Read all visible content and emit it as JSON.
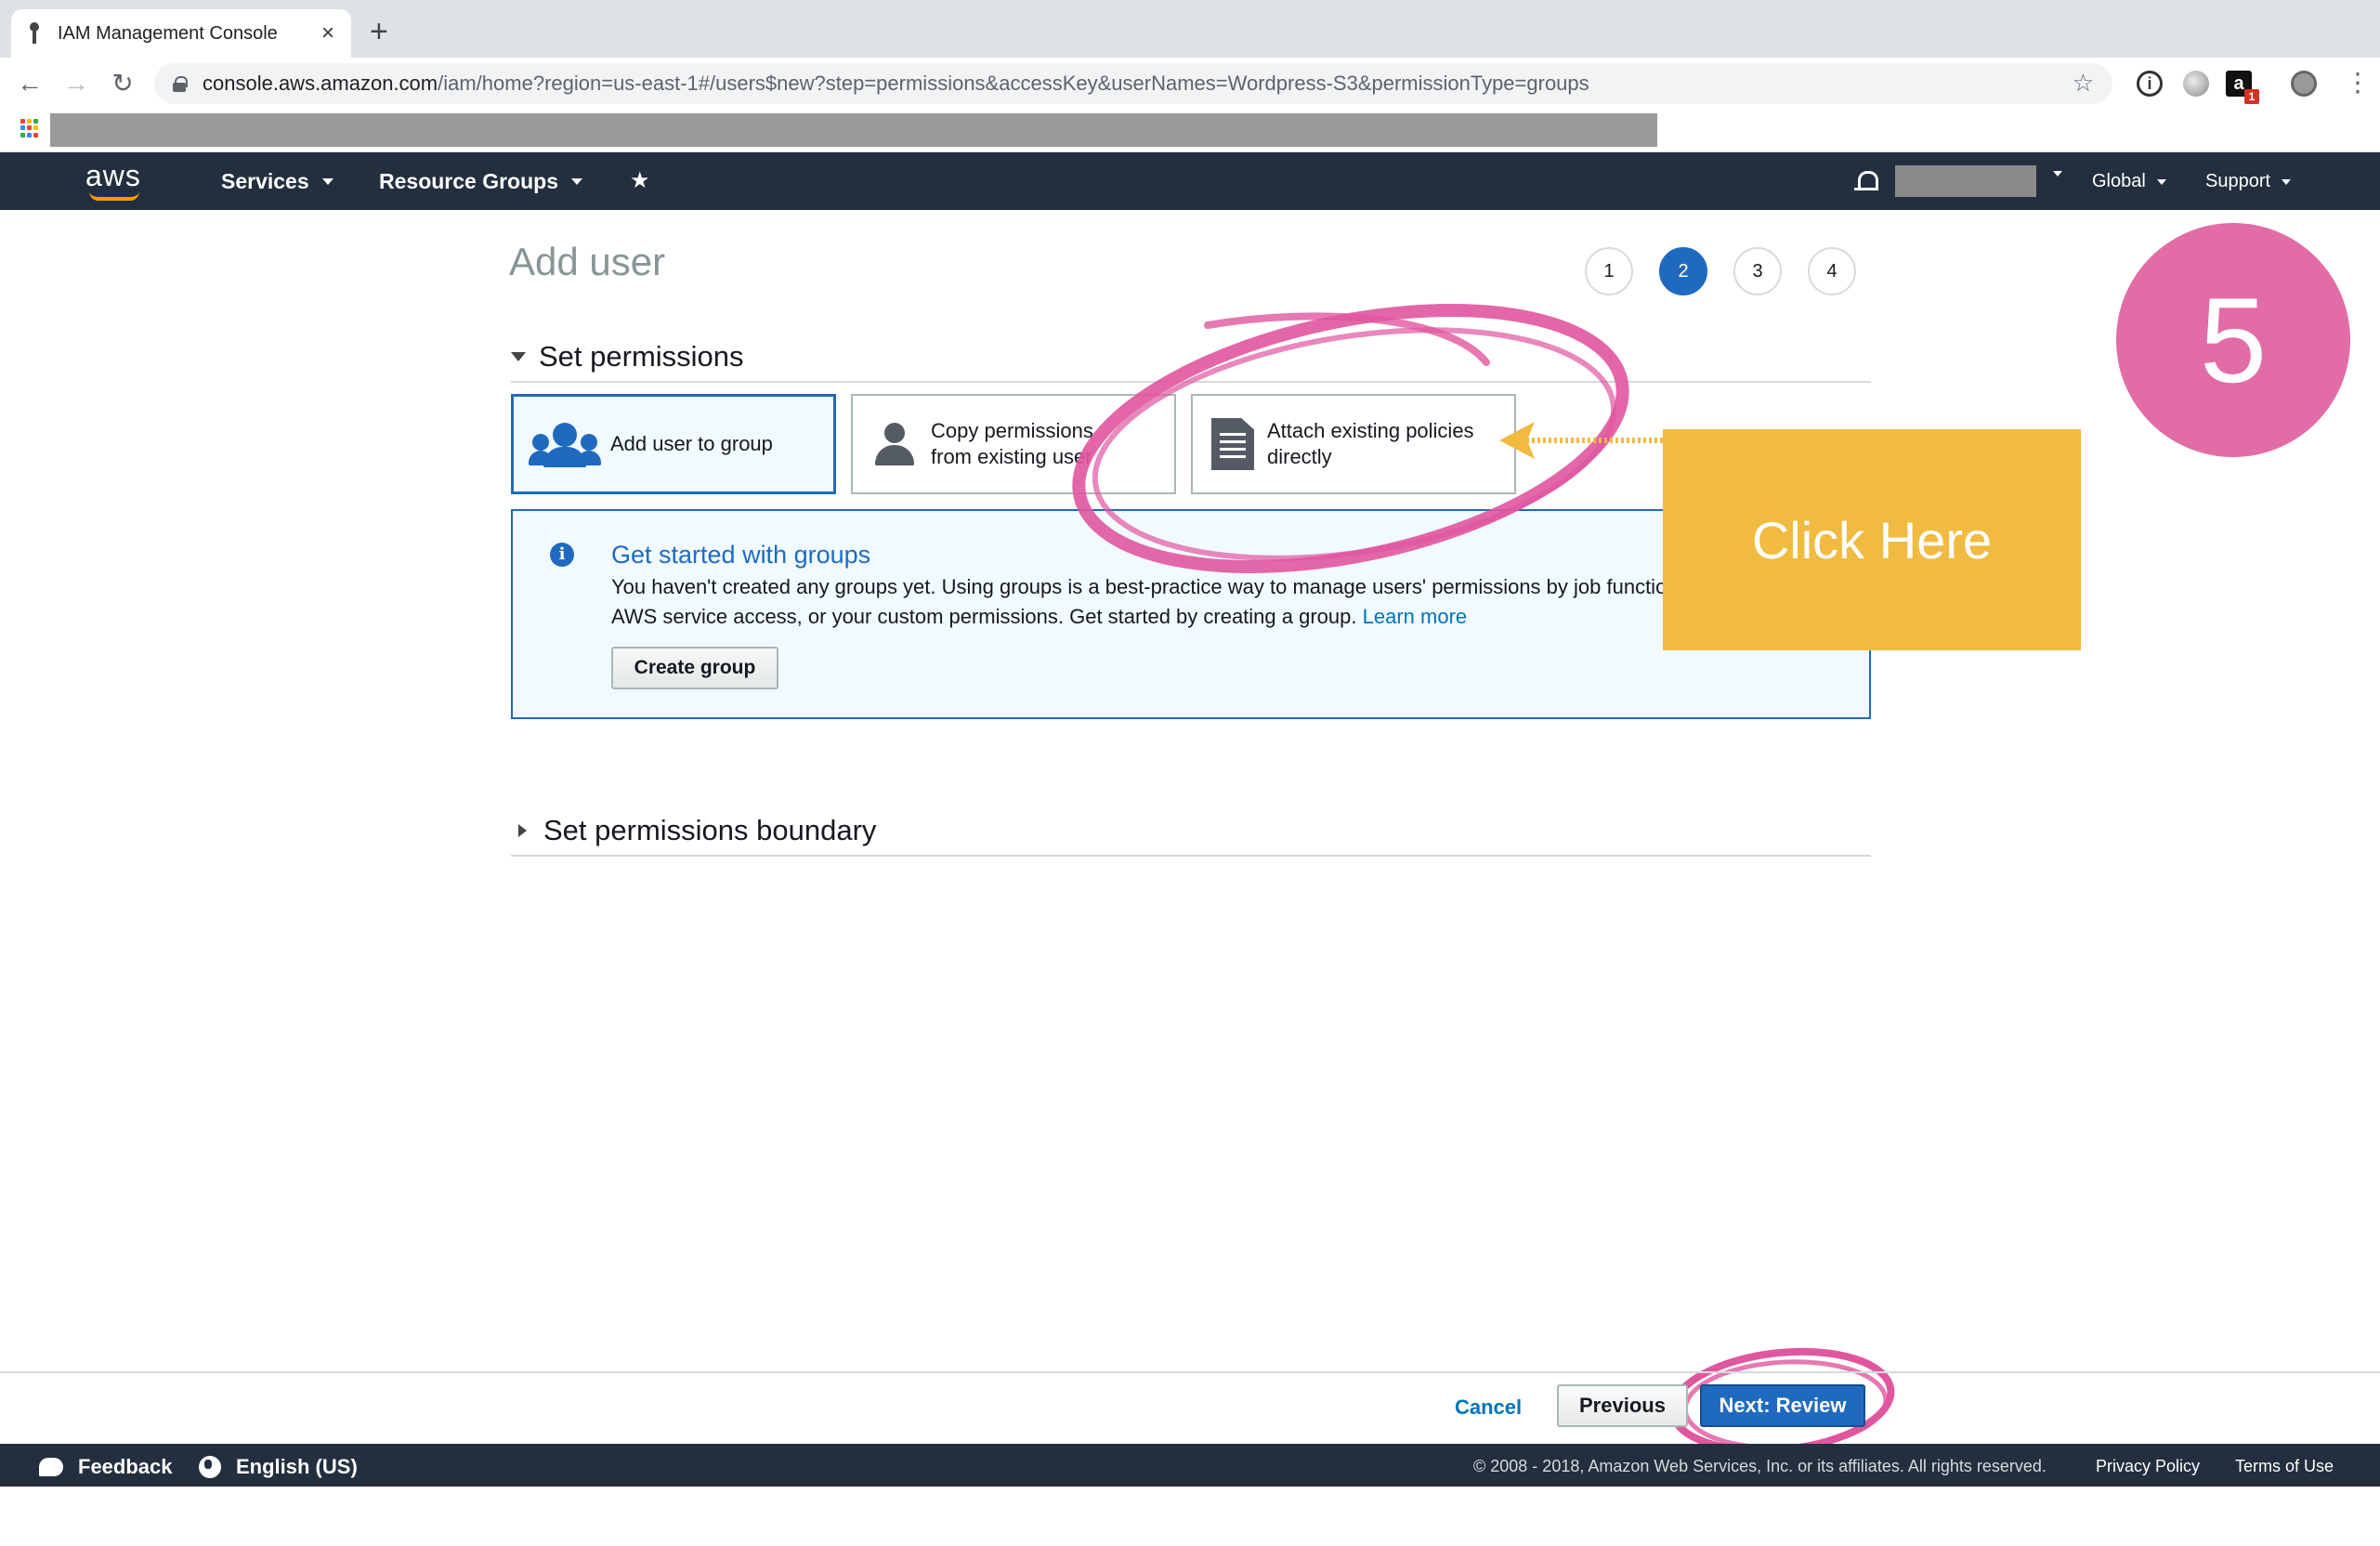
{
  "browser": {
    "tab_title": "IAM Management Console",
    "tab_close": "×",
    "new_tab": "+",
    "url_host": "console.aws.amazon.com",
    "url_path": "/iam/home?region=us-east-1#/users$new?step=permissions&accessKey&userNames=Wordpress-S3&permissionType=groups",
    "ext_amazon_letter": "a",
    "ext_amazon_badge": "1",
    "info_glyph": "i"
  },
  "aws_nav": {
    "logo": "aws",
    "services": "Services",
    "resource_groups": "Resource Groups",
    "region": "Global",
    "support": "Support"
  },
  "page": {
    "title": "Add user",
    "steps": [
      "1",
      "2",
      "3",
      "4"
    ],
    "active_step": "2"
  },
  "permissions": {
    "section_title": "Set permissions",
    "options": [
      {
        "label": "Add user to group",
        "selected": true,
        "icon": "users-icon"
      },
      {
        "label": "Copy permissions from existing user",
        "selected": false,
        "icon": "user-icon"
      },
      {
        "label": "Attach existing policies directly",
        "selected": false,
        "icon": "document-icon"
      }
    ]
  },
  "info_box": {
    "icon": "i",
    "title": "Get started with groups",
    "text": "You haven't created any groups yet. Using groups is a best-practice way to manage users' permissions by job functions, AWS service access, or your custom permissions. Get started by creating a group.",
    "link": "Learn more",
    "button": "Create group"
  },
  "boundary": {
    "section_title": "Set permissions boundary"
  },
  "actions": {
    "cancel": "Cancel",
    "previous": "Previous",
    "next": "Next: Review"
  },
  "annotations": {
    "step_number": "5",
    "callout": "Click Here",
    "colors": {
      "highlight": "#e0569f",
      "callout": "#f0bb40",
      "badge": "#e26ca6"
    }
  },
  "footer": {
    "feedback": "Feedback",
    "language": "English (US)",
    "copyright": "© 2008 - 2018, Amazon Web Services, Inc. or its affiliates. All rights reserved.",
    "privacy": "Privacy Policy",
    "terms": "Terms of Use"
  }
}
